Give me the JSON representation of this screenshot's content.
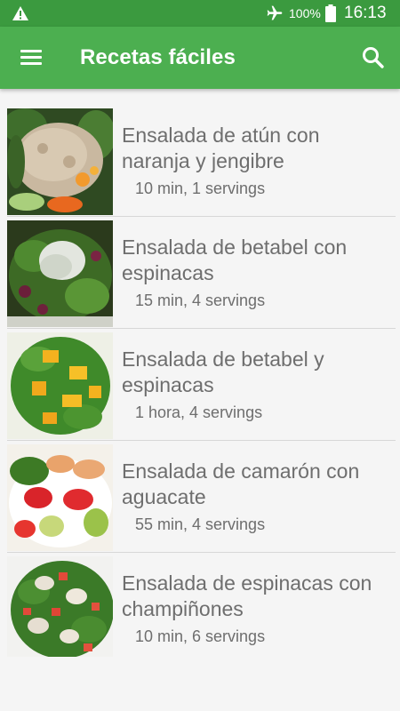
{
  "status_bar": {
    "battery_percent": "100%",
    "time": "16:13",
    "icons": [
      "warning-icon",
      "airplane-mode-icon",
      "battery-icon"
    ]
  },
  "app_bar": {
    "title": "Recetas fáciles",
    "icons": [
      "menu-icon",
      "search-icon"
    ],
    "color": "#4caf50",
    "status_color": "#3b9a3f"
  },
  "recipes": [
    {
      "name": "Ensalada de atún con naranja y jengibre",
      "meta": "10 min, 1 servings"
    },
    {
      "name": "Ensalada de betabel con espinacas",
      "meta": "15 min, 4 servings"
    },
    {
      "name": "Ensalada de betabel y espinacas",
      "meta": "1 hora, 4 servings"
    },
    {
      "name": "Ensalada de camarón con aguacate",
      "meta": "55 min, 4 servings"
    },
    {
      "name": "Ensalada de espinacas con champiñones",
      "meta": "10 min, 6 servings"
    }
  ]
}
